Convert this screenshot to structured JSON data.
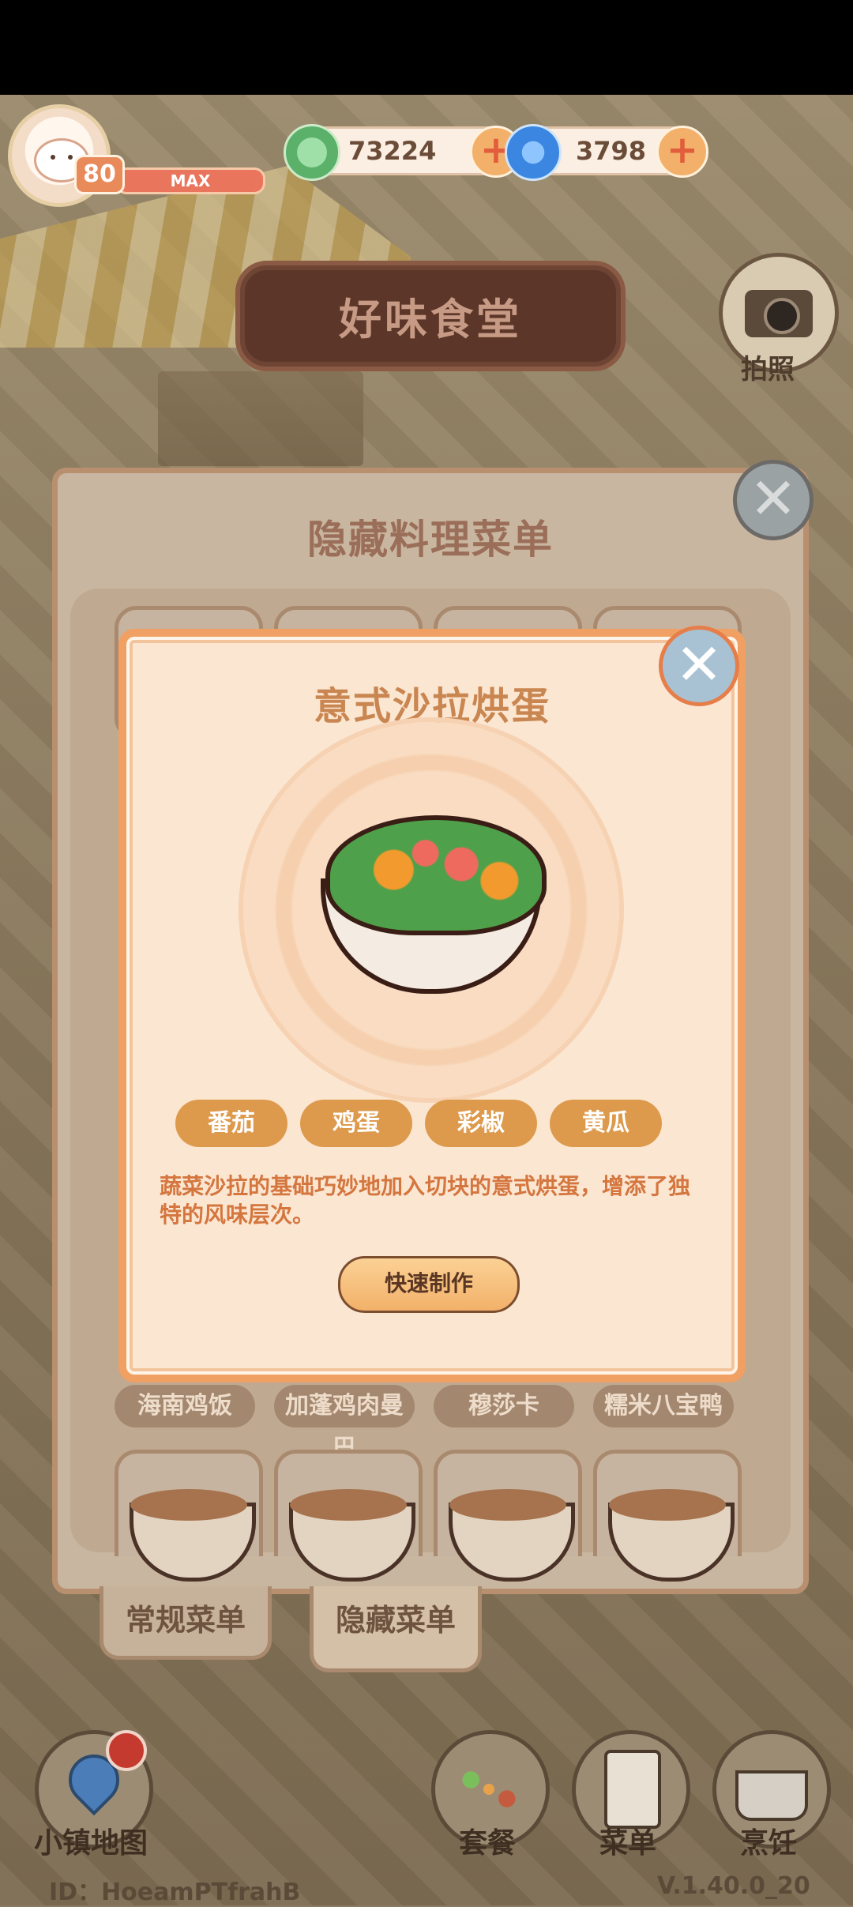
{
  "hud": {
    "level": "80",
    "xp_label": "MAX",
    "currency_green": "73224",
    "currency_blue": "3798",
    "plus": "+"
  },
  "scene": {
    "restaurant_sign": "好味食堂",
    "camera_label": "拍照"
  },
  "hidden_menu": {
    "title": "隐藏料理菜单",
    "close": "✕",
    "dish_names": [
      "海南鸡饭",
      "加蓬鸡肉曼巴",
      "穆莎卡",
      "糯米八宝鸭"
    ],
    "tabs": [
      {
        "label": "常规菜单",
        "active": false
      },
      {
        "label": "隐藏菜单",
        "active": true
      }
    ]
  },
  "recipe_detail": {
    "title": "意式沙拉烘蛋",
    "close": "✕",
    "ingredients": [
      "番茄",
      "鸡蛋",
      "彩椒",
      "黄瓜"
    ],
    "description": "蔬菜沙拉的基础巧妙地加入切块的意式烘蛋，增添了独特的风味层次。",
    "quick_make": "快速制作"
  },
  "bottom_nav": {
    "map": "小镇地图",
    "combo": "套餐",
    "menu": "菜单",
    "cook": "烹饪"
  },
  "footer": {
    "id": "ID：HoeamPTfrahB",
    "version": "V.1.40.0_20"
  },
  "colors": {
    "accent_orange": "#efa062",
    "ingredient_chip": "#dd9a4c",
    "description_text": "#d4763e"
  }
}
